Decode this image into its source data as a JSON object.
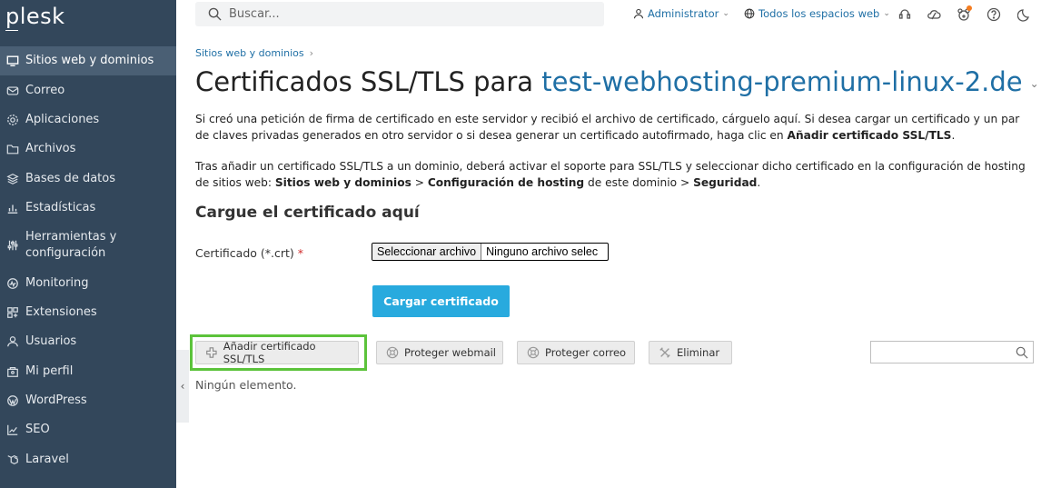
{
  "app": {
    "logo": "plesk"
  },
  "sidebar": {
    "items": [
      {
        "label": "Sitios web y dominios",
        "icon": "monitor-icon",
        "active": true
      },
      {
        "label": "Correo",
        "icon": "mail-icon"
      },
      {
        "label": "Aplicaciones",
        "icon": "gear-icon"
      },
      {
        "label": "Archivos",
        "icon": "folder-icon"
      },
      {
        "label": "Bases de datos",
        "icon": "database-icon"
      },
      {
        "label": "Estadísticas",
        "icon": "bar-chart-icon"
      },
      {
        "label": "Herramientas y configuración",
        "icon": "sliders-icon"
      },
      {
        "label": "Monitoring",
        "icon": "monitoring-icon"
      },
      {
        "label": "Extensiones",
        "icon": "extensions-icon"
      },
      {
        "label": "Usuarios",
        "icon": "user-icon"
      },
      {
        "label": "Mi perfil",
        "icon": "profile-icon"
      },
      {
        "label": "WordPress",
        "icon": "wordpress-icon"
      },
      {
        "label": "SEO",
        "icon": "seo-icon"
      },
      {
        "label": "Laravel",
        "icon": "laravel-icon"
      }
    ]
  },
  "topbar": {
    "search_placeholder": "Buscar...",
    "user_label": "Administrator",
    "subscriptions_label": "Todos los espacios web",
    "icons": [
      "support-icon",
      "cloud-icon",
      "bear-icon",
      "help-icon",
      "moon-icon"
    ]
  },
  "main": {
    "breadcrumb": "Sitios web y dominios",
    "title_prefix": "Certificados SSL/TLS para",
    "title_domain": "test-webhosting-premium-linux-2.de",
    "para1": {
      "text_a": "Si creó una petición de firma de certificado en este servidor y recibió el archivo de certificado, cárguelo aquí. Si desea cargar un certificado y un par de claves privadas generados en otro servidor o si desea generar un certificado autofirmado, haga clic en ",
      "bold_a": "Añadir certificado SSL/TLS",
      "text_b": "."
    },
    "para2": {
      "text_a": "Tras añadir un certificado SSL/TLS a un dominio, deberá activar el soporte para SSL/TLS y seleccionar dicho certificado en la configuración de hosting de sitios web: ",
      "bold_a": "Sitios web y dominios",
      "text_b": " > ",
      "bold_b": "Configuración de hosting",
      "text_c": " de este dominio > ",
      "bold_c": "Seguridad",
      "text_d": "."
    },
    "upload_section_title": "Cargue el certificado aquí",
    "cert_label": "Certificado (*.crt)",
    "required_mark": "*",
    "file_button": "Seleccionar archivo",
    "file_status": "Ninguno archivo selec",
    "upload_button": "Cargar certificado",
    "toolbar": {
      "add": "Añadir certificado SSL/TLS",
      "webmail": "Proteger webmail",
      "mail": "Proteger correo",
      "delete": "Eliminar"
    },
    "empty_text": "Ningún elemento.",
    "collapse_glyph": "‹"
  },
  "colors": {
    "sidebar_bg": "#33475b",
    "accent_link": "#1f6fa5",
    "primary_button": "#28aade",
    "highlight": "#5cc33b"
  }
}
